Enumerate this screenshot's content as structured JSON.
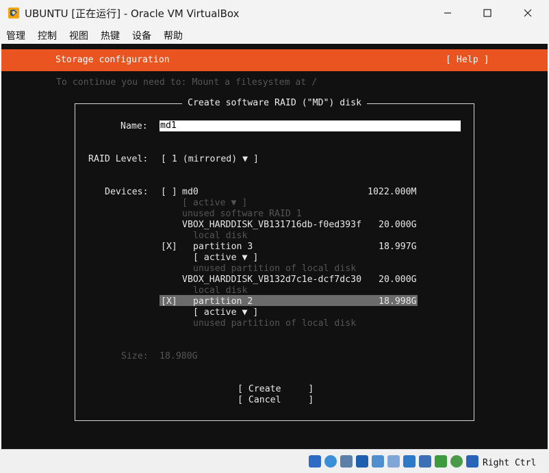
{
  "window": {
    "title": "UBUNTU [正在运行] - Oracle VM VirtualBox",
    "controls": [
      "minimize",
      "maximize",
      "close"
    ]
  },
  "menu": [
    "管理",
    "控制",
    "视图",
    "热键",
    "设备",
    "帮助"
  ],
  "installer": {
    "header_title": "Storage configuration",
    "help_label": "[ Help ]",
    "hint": "To continue you need to: Mount a filesystem at /",
    "dialog": {
      "title": "Create software RAID (\"MD\") disk",
      "name_label": "Name:",
      "name_value": "md1",
      "raid_label": "RAID Level:",
      "raid_value": "[ 1 (mirrored) ▼ ]",
      "devices_label": "Devices:",
      "devices": [
        {
          "check": "[ ]",
          "name": "md0",
          "size": "1022.000M",
          "role": "[ active ▼ ]",
          "desc": "unused software RAID 1"
        },
        {
          "name": "VBOX_HARDDISK_VB131716db-f0ed393f",
          "size": "20.000G",
          "desc": "local disk"
        },
        {
          "check": "[X]",
          "name": "partition 3",
          "size": "18.997G",
          "role": "[ active ▼ ]",
          "desc": "unused partition of local disk"
        },
        {
          "name": "VBOX_HARDDISK_VB132d7c1e-dcf7dc30",
          "size": "20.000G",
          "desc": "local disk"
        },
        {
          "check": "[X]",
          "name": "partition 2",
          "size": "18.998G",
          "role": "[ active ▼ ]",
          "desc": "unused partition of local disk"
        }
      ],
      "size_label": "Size:",
      "size_value": "18.980G",
      "create_button": "[ Create     ]",
      "cancel_button": "[ Cancel     ]"
    }
  },
  "statusbar": {
    "host_key": "Right Ctrl"
  },
  "colors": {
    "header_bg": "#e95420",
    "screen_bg": "#111111",
    "highlight_bg": "#6b6b6b"
  }
}
